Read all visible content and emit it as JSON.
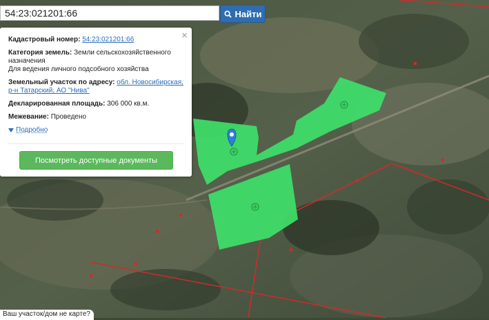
{
  "search": {
    "value": "54:23:021201:66",
    "button_label": "Найти"
  },
  "panel": {
    "close_glyph": "×",
    "cadastral": {
      "label": "Кадастровый номер:",
      "value": "54:23:021201:66"
    },
    "category": {
      "label": "Категория земель:",
      "value": "Земли сельскохозяйственного назначения",
      "use": "Для ведения личного подсобного хозяйства"
    },
    "address": {
      "label": "Земельный участок по адресу:",
      "value": "обл. Новосибирская, р-н Татарский, АО \"Нива\""
    },
    "area": {
      "label": "Декларированная площадь:",
      "value": "306 000 кв.м."
    },
    "survey": {
      "label": "Межевание:",
      "value": "Проведено"
    },
    "more_label": "Подробно",
    "docs_button": "Посмотреть доступные документы"
  },
  "hint_text": "Ваш участок/дом не карте?",
  "map": {
    "parcel_color": "#3ee06a",
    "boundary_color": "#d22a2a",
    "marker_color": "#2f7fd6",
    "parcel_icons": [
      "parcel-icon",
      "parcel-icon",
      "parcel-icon"
    ]
  }
}
